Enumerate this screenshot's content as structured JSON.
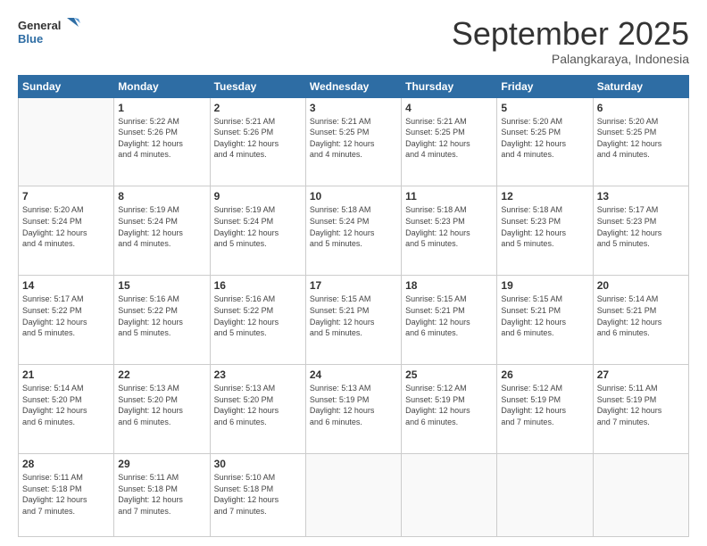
{
  "logo": {
    "line1": "General",
    "line2": "Blue"
  },
  "title": "September 2025",
  "subtitle": "Palangkaraya, Indonesia",
  "header_days": [
    "Sunday",
    "Monday",
    "Tuesday",
    "Wednesday",
    "Thursday",
    "Friday",
    "Saturday"
  ],
  "weeks": [
    [
      {
        "day": "",
        "info": ""
      },
      {
        "day": "1",
        "info": "Sunrise: 5:22 AM\nSunset: 5:26 PM\nDaylight: 12 hours\nand 4 minutes."
      },
      {
        "day": "2",
        "info": "Sunrise: 5:21 AM\nSunset: 5:26 PM\nDaylight: 12 hours\nand 4 minutes."
      },
      {
        "day": "3",
        "info": "Sunrise: 5:21 AM\nSunset: 5:25 PM\nDaylight: 12 hours\nand 4 minutes."
      },
      {
        "day": "4",
        "info": "Sunrise: 5:21 AM\nSunset: 5:25 PM\nDaylight: 12 hours\nand 4 minutes."
      },
      {
        "day": "5",
        "info": "Sunrise: 5:20 AM\nSunset: 5:25 PM\nDaylight: 12 hours\nand 4 minutes."
      },
      {
        "day": "6",
        "info": "Sunrise: 5:20 AM\nSunset: 5:25 PM\nDaylight: 12 hours\nand 4 minutes."
      }
    ],
    [
      {
        "day": "7",
        "info": "Sunrise: 5:20 AM\nSunset: 5:24 PM\nDaylight: 12 hours\nand 4 minutes."
      },
      {
        "day": "8",
        "info": "Sunrise: 5:19 AM\nSunset: 5:24 PM\nDaylight: 12 hours\nand 4 minutes."
      },
      {
        "day": "9",
        "info": "Sunrise: 5:19 AM\nSunset: 5:24 PM\nDaylight: 12 hours\nand 5 minutes."
      },
      {
        "day": "10",
        "info": "Sunrise: 5:18 AM\nSunset: 5:24 PM\nDaylight: 12 hours\nand 5 minutes."
      },
      {
        "day": "11",
        "info": "Sunrise: 5:18 AM\nSunset: 5:23 PM\nDaylight: 12 hours\nand 5 minutes."
      },
      {
        "day": "12",
        "info": "Sunrise: 5:18 AM\nSunset: 5:23 PM\nDaylight: 12 hours\nand 5 minutes."
      },
      {
        "day": "13",
        "info": "Sunrise: 5:17 AM\nSunset: 5:23 PM\nDaylight: 12 hours\nand 5 minutes."
      }
    ],
    [
      {
        "day": "14",
        "info": "Sunrise: 5:17 AM\nSunset: 5:22 PM\nDaylight: 12 hours\nand 5 minutes."
      },
      {
        "day": "15",
        "info": "Sunrise: 5:16 AM\nSunset: 5:22 PM\nDaylight: 12 hours\nand 5 minutes."
      },
      {
        "day": "16",
        "info": "Sunrise: 5:16 AM\nSunset: 5:22 PM\nDaylight: 12 hours\nand 5 minutes."
      },
      {
        "day": "17",
        "info": "Sunrise: 5:15 AM\nSunset: 5:21 PM\nDaylight: 12 hours\nand 5 minutes."
      },
      {
        "day": "18",
        "info": "Sunrise: 5:15 AM\nSunset: 5:21 PM\nDaylight: 12 hours\nand 6 minutes."
      },
      {
        "day": "19",
        "info": "Sunrise: 5:15 AM\nSunset: 5:21 PM\nDaylight: 12 hours\nand 6 minutes."
      },
      {
        "day": "20",
        "info": "Sunrise: 5:14 AM\nSunset: 5:21 PM\nDaylight: 12 hours\nand 6 minutes."
      }
    ],
    [
      {
        "day": "21",
        "info": "Sunrise: 5:14 AM\nSunset: 5:20 PM\nDaylight: 12 hours\nand 6 minutes."
      },
      {
        "day": "22",
        "info": "Sunrise: 5:13 AM\nSunset: 5:20 PM\nDaylight: 12 hours\nand 6 minutes."
      },
      {
        "day": "23",
        "info": "Sunrise: 5:13 AM\nSunset: 5:20 PM\nDaylight: 12 hours\nand 6 minutes."
      },
      {
        "day": "24",
        "info": "Sunrise: 5:13 AM\nSunset: 5:19 PM\nDaylight: 12 hours\nand 6 minutes."
      },
      {
        "day": "25",
        "info": "Sunrise: 5:12 AM\nSunset: 5:19 PM\nDaylight: 12 hours\nand 6 minutes."
      },
      {
        "day": "26",
        "info": "Sunrise: 5:12 AM\nSunset: 5:19 PM\nDaylight: 12 hours\nand 7 minutes."
      },
      {
        "day": "27",
        "info": "Sunrise: 5:11 AM\nSunset: 5:19 PM\nDaylight: 12 hours\nand 7 minutes."
      }
    ],
    [
      {
        "day": "28",
        "info": "Sunrise: 5:11 AM\nSunset: 5:18 PM\nDaylight: 12 hours\nand 7 minutes."
      },
      {
        "day": "29",
        "info": "Sunrise: 5:11 AM\nSunset: 5:18 PM\nDaylight: 12 hours\nand 7 minutes."
      },
      {
        "day": "30",
        "info": "Sunrise: 5:10 AM\nSunset: 5:18 PM\nDaylight: 12 hours\nand 7 minutes."
      },
      {
        "day": "",
        "info": ""
      },
      {
        "day": "",
        "info": ""
      },
      {
        "day": "",
        "info": ""
      },
      {
        "day": "",
        "info": ""
      }
    ]
  ]
}
